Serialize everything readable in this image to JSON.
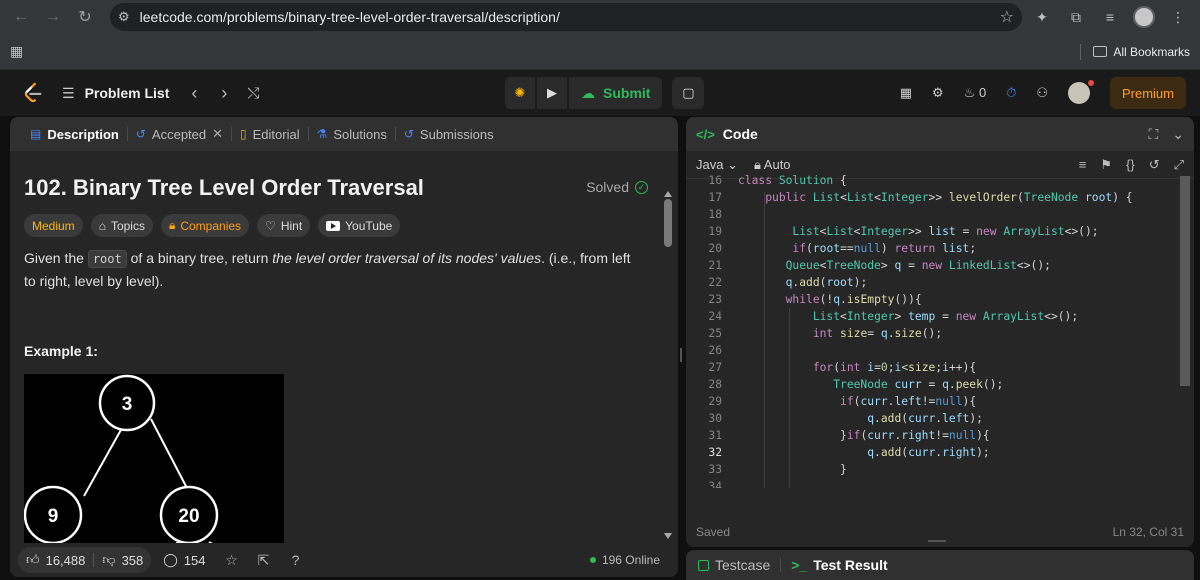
{
  "browser": {
    "url": "leetcode.com/problems/binary-tree-level-order-traversal/description/",
    "bookmarks_label": "All Bookmarks"
  },
  "nav": {
    "problem_list": "Problem List",
    "submit": "Submit",
    "fire_count": "0",
    "premium": "Premium"
  },
  "left_tabs": [
    {
      "label": "Description"
    },
    {
      "label": "Accepted"
    },
    {
      "label": "Editorial"
    },
    {
      "label": "Solutions"
    },
    {
      "label": "Submissions"
    }
  ],
  "problem": {
    "title": "102. Binary Tree Level Order Traversal",
    "status": "Solved",
    "chips": [
      "Medium",
      "Topics",
      "Companies",
      "Hint",
      "YouTube"
    ],
    "desc_pre": "Given the ",
    "desc_code": "root",
    "desc_mid": " of a binary tree, return ",
    "desc_em": "the level order traversal of its nodes' values",
    "desc_post": ". (i.e., from left to right, level by level).",
    "example_title": "Example 1:",
    "tree_nodes": [
      "3",
      "9",
      "20"
    ]
  },
  "footer": {
    "likes": "16,488",
    "dislikes": "358",
    "comments": "154",
    "online": "196 Online"
  },
  "code": {
    "title": "Code",
    "tag": "</>",
    "lang": "Java",
    "mode": "Auto",
    "status": "Saved",
    "position": "Ln 32, Col 31",
    "current_line": 32,
    "lines": [
      {
        "n": 16,
        "t": "class Solution {"
      },
      {
        "n": 17,
        "t": "    public List<List<Integer>> levelOrder(TreeNode root) {"
      },
      {
        "n": 18,
        "t": ""
      },
      {
        "n": 19,
        "t": "        List<List<Integer>> list = new ArrayList<>();"
      },
      {
        "n": 20,
        "t": "        if(root==null) return list;"
      },
      {
        "n": 21,
        "t": "       Queue<TreeNode> q = new LinkedList<>();"
      },
      {
        "n": 22,
        "t": "       q.add(root);"
      },
      {
        "n": 23,
        "t": "       while(!q.isEmpty()){"
      },
      {
        "n": 24,
        "t": "           List<Integer> temp = new ArrayList<>();"
      },
      {
        "n": 25,
        "t": "           int size= q.size();"
      },
      {
        "n": 26,
        "t": ""
      },
      {
        "n": 27,
        "t": "           for(int i=0;i<size;i++){"
      },
      {
        "n": 28,
        "t": "              TreeNode curr = q.peek();"
      },
      {
        "n": 29,
        "t": "               if(curr.left!=null){"
      },
      {
        "n": 30,
        "t": "                   q.add(curr.left);"
      },
      {
        "n": 31,
        "t": "               }if(curr.right!=null){"
      },
      {
        "n": 32,
        "t": "                   q.add(curr.right);"
      },
      {
        "n": 33,
        "t": "               }"
      },
      {
        "n": 34,
        "t": ""
      }
    ]
  },
  "bottom_tabs": [
    "Testcase",
    "Test Result"
  ]
}
